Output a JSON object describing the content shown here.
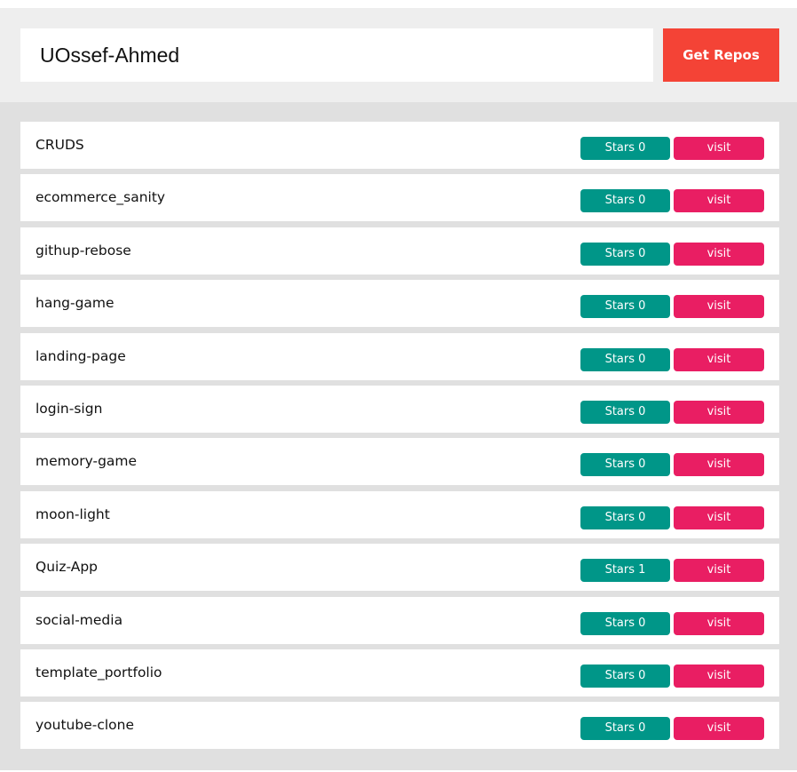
{
  "search": {
    "value": "UOssef-Ahmed",
    "button_label": "Get Repos"
  },
  "repos": [
    {
      "name": "CRUDS",
      "stars_label": "Stars 0",
      "visit_label": "visit"
    },
    {
      "name": "ecommerce_sanity",
      "stars_label": "Stars 0",
      "visit_label": "visit"
    },
    {
      "name": "githup-rebose",
      "stars_label": "Stars 0",
      "visit_label": "visit"
    },
    {
      "name": "hang-game",
      "stars_label": "Stars 0",
      "visit_label": "visit"
    },
    {
      "name": "landing-page",
      "stars_label": "Stars 0",
      "visit_label": "visit"
    },
    {
      "name": "login-sign",
      "stars_label": "Stars 0",
      "visit_label": "visit"
    },
    {
      "name": "memory-game",
      "stars_label": "Stars 0",
      "visit_label": "visit"
    },
    {
      "name": "moon-light",
      "stars_label": "Stars 0",
      "visit_label": "visit"
    },
    {
      "name": "Quiz-App",
      "stars_label": "Stars 1",
      "visit_label": "visit"
    },
    {
      "name": "social-media",
      "stars_label": "Stars 0",
      "visit_label": "visit"
    },
    {
      "name": "template_portfolio",
      "stars_label": "Stars 0",
      "visit_label": "visit"
    },
    {
      "name": "youtube-clone",
      "stars_label": "Stars 0",
      "visit_label": "visit"
    }
  ],
  "colors": {
    "search_bar_bg": "#eeeeee",
    "panel_bg": "#e0e0e0",
    "button_bg": "#f44336",
    "stars_bg": "#009688",
    "visit_bg": "#e91e63"
  }
}
